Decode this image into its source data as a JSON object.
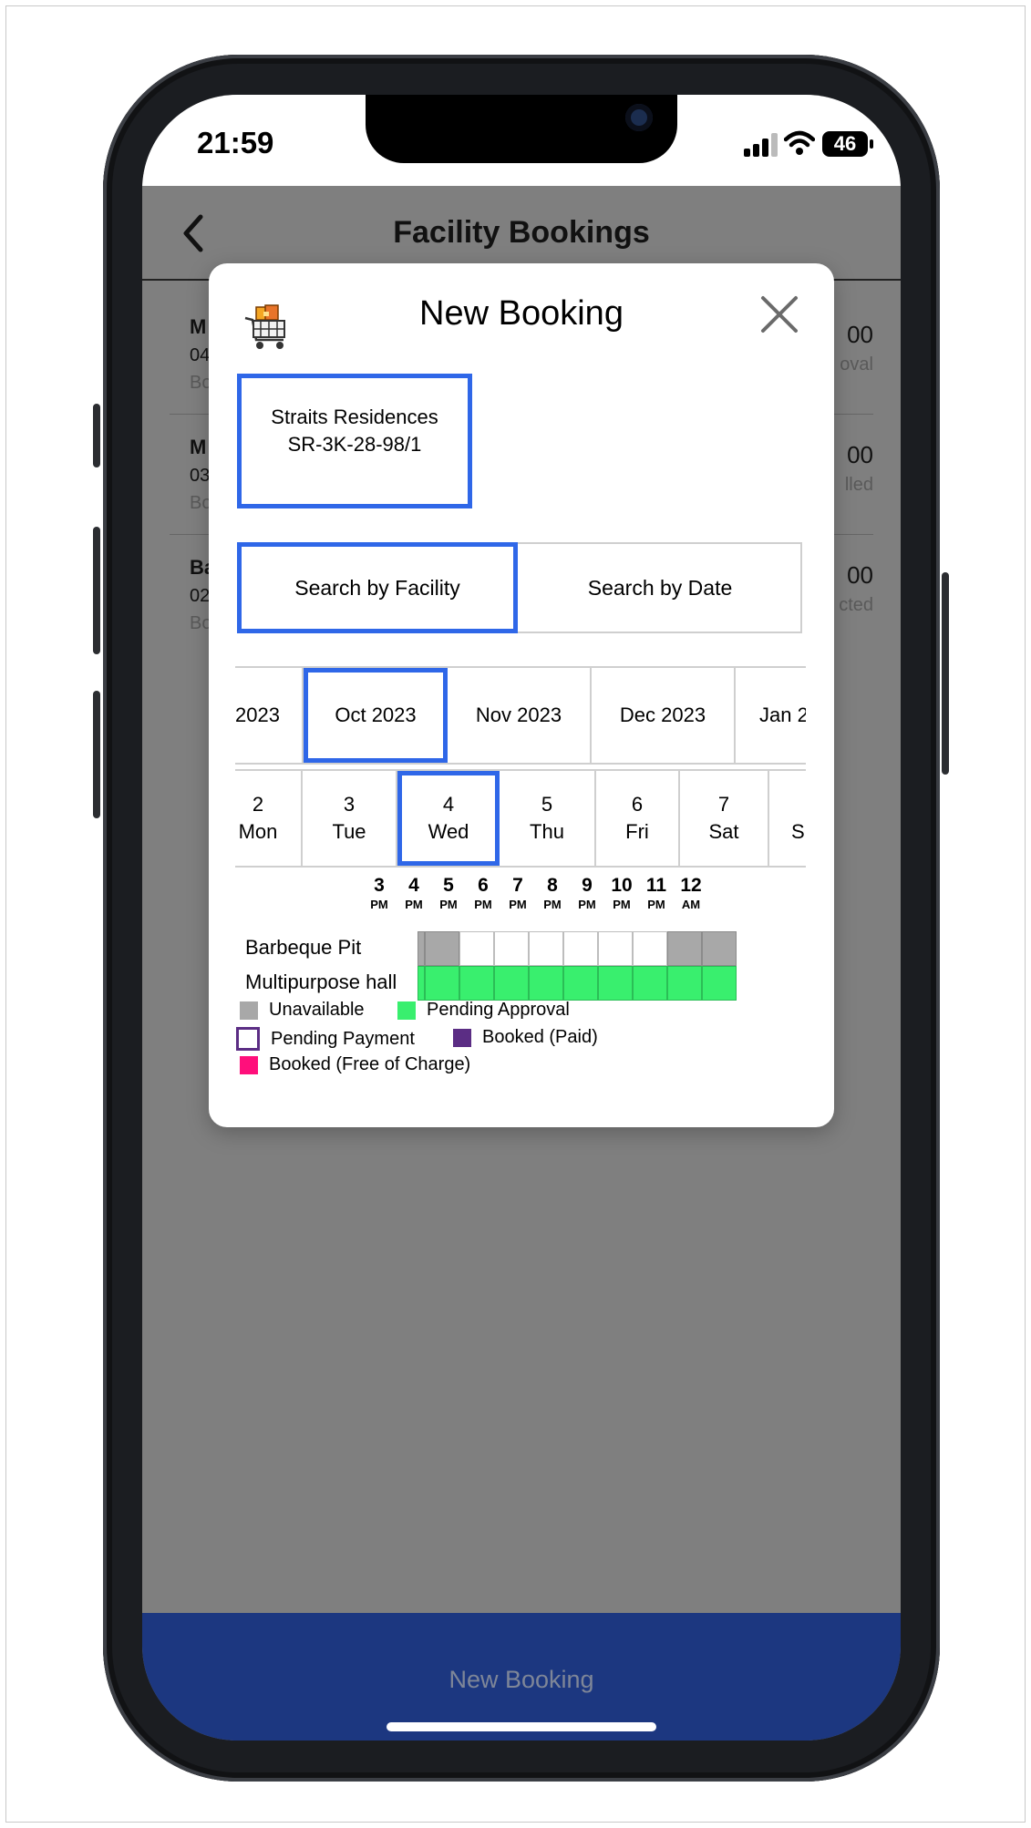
{
  "status_bar": {
    "time": "21:59",
    "battery": "46"
  },
  "header": {
    "title": "Facility Bookings"
  },
  "background_list": [
    {
      "name": "M",
      "date": "04",
      "status_short": "Bo",
      "price": "00",
      "status_right": "oval"
    },
    {
      "name": "M",
      "date": "03",
      "status_short": "Bo",
      "price": "00",
      "status_right": "lled"
    },
    {
      "name": "Ba",
      "date": "02",
      "status_short": "Bo",
      "price": "00",
      "status_right": "cted"
    }
  ],
  "bottom_bar": {
    "label": "New Booking"
  },
  "modal": {
    "title": "New Booking",
    "property": {
      "line1": "Straits Residences",
      "line2": "SR-3K-28-98/1"
    },
    "tabs": [
      "Search by Facility",
      "Search by Date"
    ],
    "months": [
      "2023",
      "Oct 2023",
      "Nov 2023",
      "Dec 2023",
      "Jan 2"
    ],
    "selected_month": "Oct 2023",
    "days": [
      {
        "num": "2",
        "dow": "Mon"
      },
      {
        "num": "3",
        "dow": "Tue"
      },
      {
        "num": "4",
        "dow": "Wed"
      },
      {
        "num": "5",
        "dow": "Thu"
      },
      {
        "num": "6",
        "dow": "Fri"
      },
      {
        "num": "7",
        "dow": "Sat"
      },
      {
        "num": "",
        "dow": "S"
      }
    ],
    "selected_day": "4",
    "time_slots": [
      {
        "n": "3",
        "ap": "PM"
      },
      {
        "n": "4",
        "ap": "PM"
      },
      {
        "n": "5",
        "ap": "PM"
      },
      {
        "n": "6",
        "ap": "PM"
      },
      {
        "n": "7",
        "ap": "PM"
      },
      {
        "n": "8",
        "ap": "PM"
      },
      {
        "n": "9",
        "ap": "PM"
      },
      {
        "n": "10",
        "ap": "PM"
      },
      {
        "n": "11",
        "ap": "PM"
      },
      {
        "n": "12",
        "ap": "AM"
      }
    ],
    "facilities": [
      {
        "name": "Barbeque Pit",
        "slots": [
          "u",
          "a",
          "a",
          "a",
          "a",
          "a",
          "a",
          "u",
          "u"
        ]
      },
      {
        "name": "Multipurpose hall",
        "slots": [
          "p",
          "p",
          "p",
          "p",
          "p",
          "p",
          "p",
          "p",
          "p"
        ]
      }
    ],
    "legend": [
      {
        "label": "Unavailable",
        "color": "#a8a8a8"
      },
      {
        "label": "Pending Approval",
        "color": "#39ef6e"
      },
      {
        "label": "Pending Payment",
        "color": "#ffffff",
        "outline": "#5b2d84"
      },
      {
        "label": "Booked (Paid)",
        "color": "#5b2d84"
      },
      {
        "label": "Booked (Free of Charge)",
        "color": "#ff0f7b"
      }
    ]
  },
  "colors": {
    "accent_blue": "#2f67e8",
    "bottom_bar": "#1c3780"
  }
}
